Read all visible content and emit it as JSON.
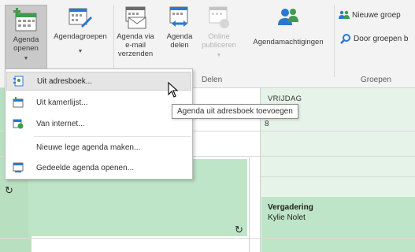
{
  "ribbon": {
    "buttons": {
      "open_calendar": {
        "label": "Agenda openen",
        "icon": "calendar-add-icon"
      },
      "calendar_groups": {
        "label": "Agendagroepen",
        "icon": "calendar-groups-icon"
      },
      "email_calendar": {
        "label": "Agenda via e-mail verzenden",
        "icon": "calendar-email-icon"
      },
      "share_calendar": {
        "label": "Agenda delen",
        "icon": "calendar-share-icon"
      },
      "publish_online": {
        "label": "Online publiceren",
        "icon": "calendar-publish-icon",
        "disabled": true
      },
      "calendar_permissions": {
        "label": "Agendamachtigingen",
        "icon": "people-permissions-icon"
      }
    },
    "group_share_label": "Delen",
    "new_group_label": "Nieuwe groep",
    "browse_groups_label": "Door groepen b",
    "group_groups_label": "Groepen"
  },
  "menu": {
    "items": [
      {
        "label": "Uit adresboek...",
        "icon": "address-book-icon",
        "hover": true
      },
      {
        "label": "Uit kamerlijst...",
        "icon": "room-list-icon"
      },
      {
        "label": "Van internet...",
        "icon": "internet-calendar-icon"
      },
      {
        "label": "Nieuwe lege agenda maken..."
      },
      {
        "label": "Gedeelde agenda openen...",
        "icon": "shared-calendar-icon"
      }
    ]
  },
  "tooltip": {
    "text": "Agenda uit adresboek toevoegen"
  },
  "calendar": {
    "day_header": "VRIJDAG",
    "day_number": "8",
    "appointment": {
      "title": "Vergadering",
      "organizer": "Kylie Nolet"
    }
  },
  "colors": {
    "appointment_green": "#bfe5c8",
    "ribbon_bg": "#f3f3f3",
    "accent_blue": "#2b78d0",
    "accent_green": "#3f9b4f"
  }
}
